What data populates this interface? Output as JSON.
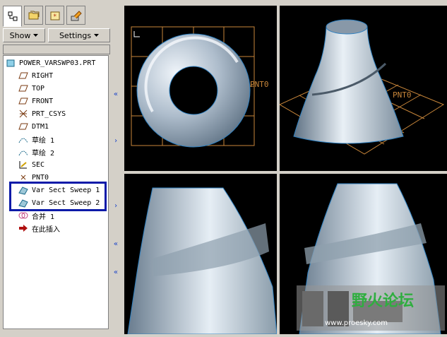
{
  "toolbar": {
    "show_label": "Show",
    "settings_label": "Settings"
  },
  "tree": {
    "root": "POWER_VARSWP03.PRT",
    "items": [
      {
        "label": "RIGHT",
        "icon": "datum-plane-icon"
      },
      {
        "label": "TOP",
        "icon": "datum-plane-icon"
      },
      {
        "label": "FRONT",
        "icon": "datum-plane-icon"
      },
      {
        "label": "PRT_CSYS",
        "icon": "csys-icon"
      },
      {
        "label": "DTM1",
        "icon": "datum-plane-icon"
      },
      {
        "label": "草绘 1",
        "icon": "sketch-icon"
      },
      {
        "label": "草绘 2",
        "icon": "sketch-icon"
      },
      {
        "label": "SEC",
        "icon": "section-icon"
      },
      {
        "label": "PNT0",
        "icon": "datum-point-icon"
      },
      {
        "label": "Var Sect Sweep 1",
        "icon": "var-sect-sweep-icon"
      },
      {
        "label": "Var Sect Sweep 2",
        "icon": "var-sect-sweep-icon"
      },
      {
        "label": "合并 1",
        "icon": "merge-icon"
      },
      {
        "label": "在此插入",
        "icon": "insert-arrow-icon"
      }
    ]
  },
  "viewports": {
    "top_left_label": "PNT0",
    "top_right_label": "PNT0"
  },
  "watermark": {
    "title": "野火论坛",
    "url": "www.proesky.com"
  },
  "colors": {
    "viewport_bg": "#000000",
    "datum": "#c8863a",
    "model_light": "#d9e4ee",
    "model_dark": "#6f8496",
    "highlight_box": "#0a1aa8"
  }
}
